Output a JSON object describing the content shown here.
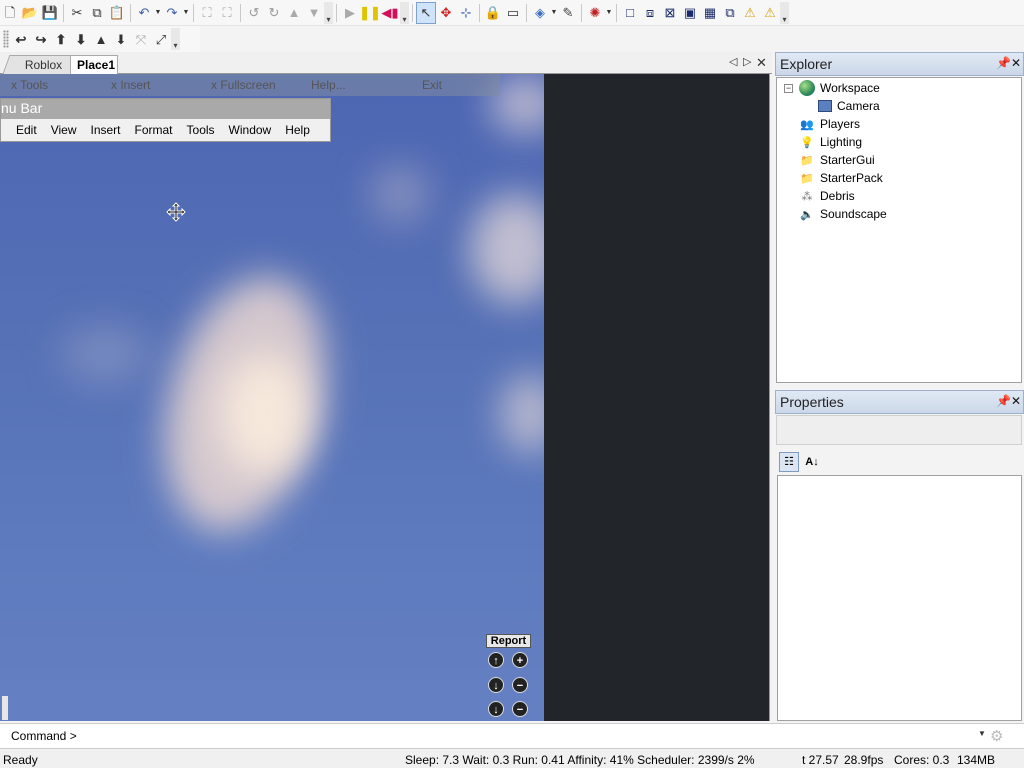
{
  "toolbar1": {
    "icons": [
      "new-file-icon",
      "open-folder-icon",
      "save-icon",
      "cut-icon",
      "copy-icon",
      "paste-icon",
      "undo-icon",
      "redo-icon",
      "group-icon",
      "ungroup-icon",
      "rotate-left-icon",
      "rotate-right-icon",
      "move-up-icon",
      "move-down-icon",
      "play-icon",
      "pause-icon",
      "reset-icon",
      "select-tool-icon",
      "move-tool-icon",
      "resize-tool-icon",
      "lock-icon",
      "anchor-icon",
      "paint-bucket-icon",
      "dropper-icon",
      "joint-icon",
      "surface-icon",
      "surface2-icon",
      "surface3-icon",
      "surface4-icon",
      "surface5-icon",
      "surface6-icon",
      "weld-icon",
      "glue-icon"
    ]
  },
  "toolbar2": {
    "icons": [
      "pan-left-icon",
      "pan-right-icon",
      "camera-up-icon",
      "camera-down-icon",
      "camera-in-icon",
      "camera-out-icon",
      "zoom-extents-icon",
      "fullscreen-icon"
    ]
  },
  "tabs": {
    "roblox": "Roblox",
    "place": "Place1"
  },
  "gui_topbar": {
    "tools": "x Tools",
    "insert": "x Insert",
    "fullscreen": "x Fullscreen",
    "help": "Help...",
    "exit": "Exit"
  },
  "menu_panel": {
    "title": "nu Bar",
    "items": [
      "Edit",
      "View",
      "Insert",
      "Format",
      "Tools",
      "Window",
      "Help"
    ]
  },
  "camera_controls": {
    "report": "Report",
    "up": "↑",
    "zoom_in": "+",
    "down": "↓",
    "zoom_out": "−",
    "down2": "↓",
    "zoom_out2": "−"
  },
  "explorer": {
    "title": "Explorer",
    "items": [
      "Workspace",
      "Camera",
      "Players",
      "Lighting",
      "StarterGui",
      "StarterPack",
      "Debris",
      "Soundscape"
    ]
  },
  "properties": {
    "title": "Properties"
  },
  "command": {
    "label": "Command >",
    "value": ""
  },
  "status": {
    "ready": "Ready",
    "stats": "Sleep: 7.3 Wait: 0.3 Run: 0.41 Affinity: 41% Scheduler: 2399/s 2%",
    "time": "t 27.57",
    "fps": "28.9fps",
    "cores": "Cores: 0.3",
    "memory": "134MB"
  }
}
